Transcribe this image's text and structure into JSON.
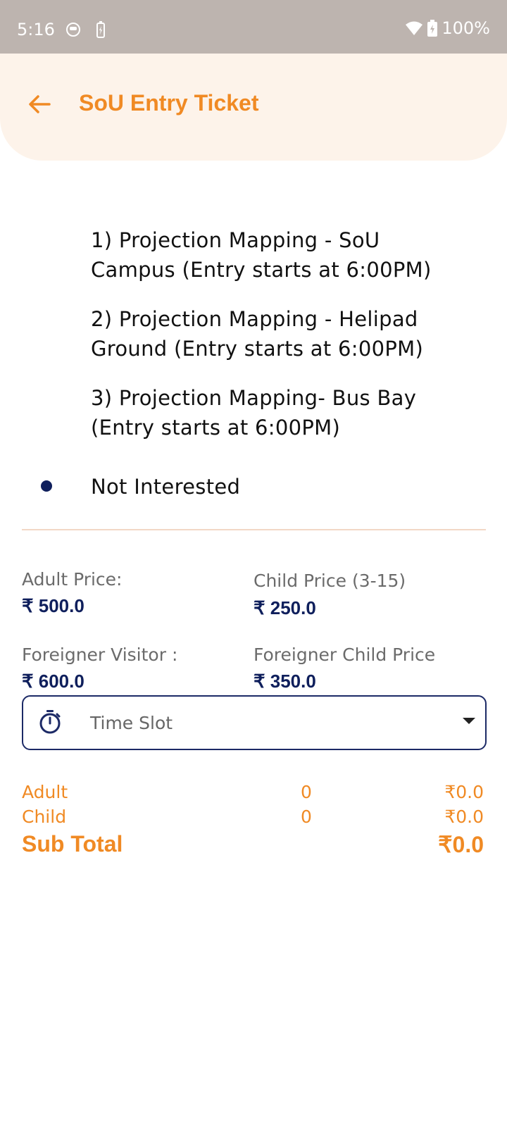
{
  "status_bar": {
    "time": "5:16",
    "battery": "100%",
    "icons": [
      "face-icon",
      "battery-saver-icon",
      "wifi-icon",
      "battery-charging-icon"
    ]
  },
  "header": {
    "title": "SoU Entry Ticket",
    "back_icon": "arrow-left-icon"
  },
  "options": [
    {
      "label": "1) Projection Mapping - SoU Campus (Entry starts at 6:00PM)",
      "selected": false
    },
    {
      "label": "2) Projection Mapping - Helipad Ground (Entry starts at 6:00PM)",
      "selected": false
    },
    {
      "label": "3) Projection Mapping- Bus Bay (Entry starts at 6:00PM)",
      "selected": false
    },
    {
      "label": "Not Interested",
      "selected": true
    }
  ],
  "prices": {
    "adult": {
      "label": "Adult Price:",
      "value": "₹ 500.0"
    },
    "child": {
      "label": "Child Price (3-15)",
      "value": "₹ 250.0"
    },
    "foreigner": {
      "label": "Foreigner Visitor :",
      "value": "₹ 600.0"
    },
    "foreigner_child": {
      "label": "Foreigner Child Price",
      "value": "₹ 350.0"
    }
  },
  "time_slot": {
    "placeholder": "Time Slot",
    "icon": "timer-icon"
  },
  "summary": {
    "rows": [
      {
        "label": "Adult",
        "qty": "0",
        "amount": "₹0.0"
      },
      {
        "label": "Child",
        "qty": "0",
        "amount": "₹0.0"
      }
    ],
    "subtotal_label": "Sub Total",
    "subtotal_value": "₹0.0"
  },
  "colors": {
    "accent": "#f08a24",
    "navy": "#0f1f5c",
    "header_bg": "#fdf3ea",
    "status_bar_bg": "#bdb4af"
  }
}
